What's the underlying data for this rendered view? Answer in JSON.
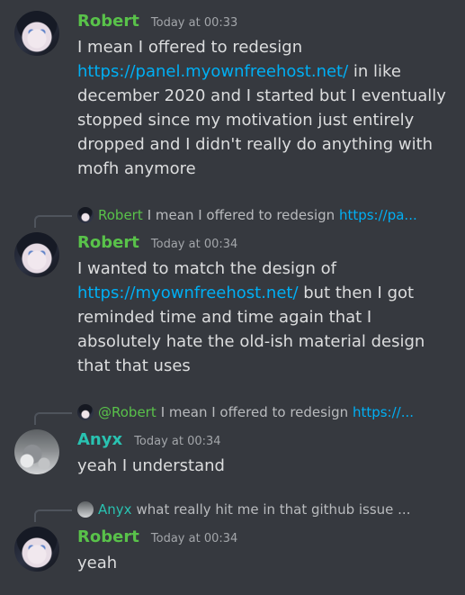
{
  "messages": [
    {
      "id": "m1",
      "author": "Robert",
      "timestamp": "Today at 00:33",
      "text_before": "I mean I offered to redesign ",
      "link": "https://panel.myownfreehost.net/",
      "text_after": " in like december 2020 and I started but I eventually stopped since my motivation just entirely dropped and I didn't really do anything with mofh anymore"
    },
    {
      "id": "m2",
      "author": "Robert",
      "timestamp": "Today at 00:34",
      "reply": {
        "author": "Robert",
        "text": "I mean I offered to redesign ",
        "link": "https://pa..."
      },
      "text_before": "I wanted to match the design of ",
      "link": "https://myownfreehost.net/",
      "text_after": " but then I got reminded time and time again that I absolutely hate the old-ish material design that that uses"
    },
    {
      "id": "m3",
      "author": "Anyx",
      "timestamp": "Today at 00:34",
      "reply": {
        "author": "@Robert",
        "text": "I mean I offered to redesign ",
        "link": "https://..."
      },
      "text": "yeah I understand"
    },
    {
      "id": "m4",
      "author": "Robert",
      "timestamp": "Today at 00:34",
      "reply": {
        "author": "Anyx",
        "text": "what really hit me in that github issue ..."
      },
      "text": "yeah"
    }
  ],
  "colors": {
    "background": "#36393f",
    "robert": "#59c24a",
    "anyx": "#29c2b1",
    "link": "#00aff4"
  },
  "icons": {
    "robert_avatar": "robert-avatar-icon",
    "anyx_avatar": "anyx-avatar-icon"
  }
}
